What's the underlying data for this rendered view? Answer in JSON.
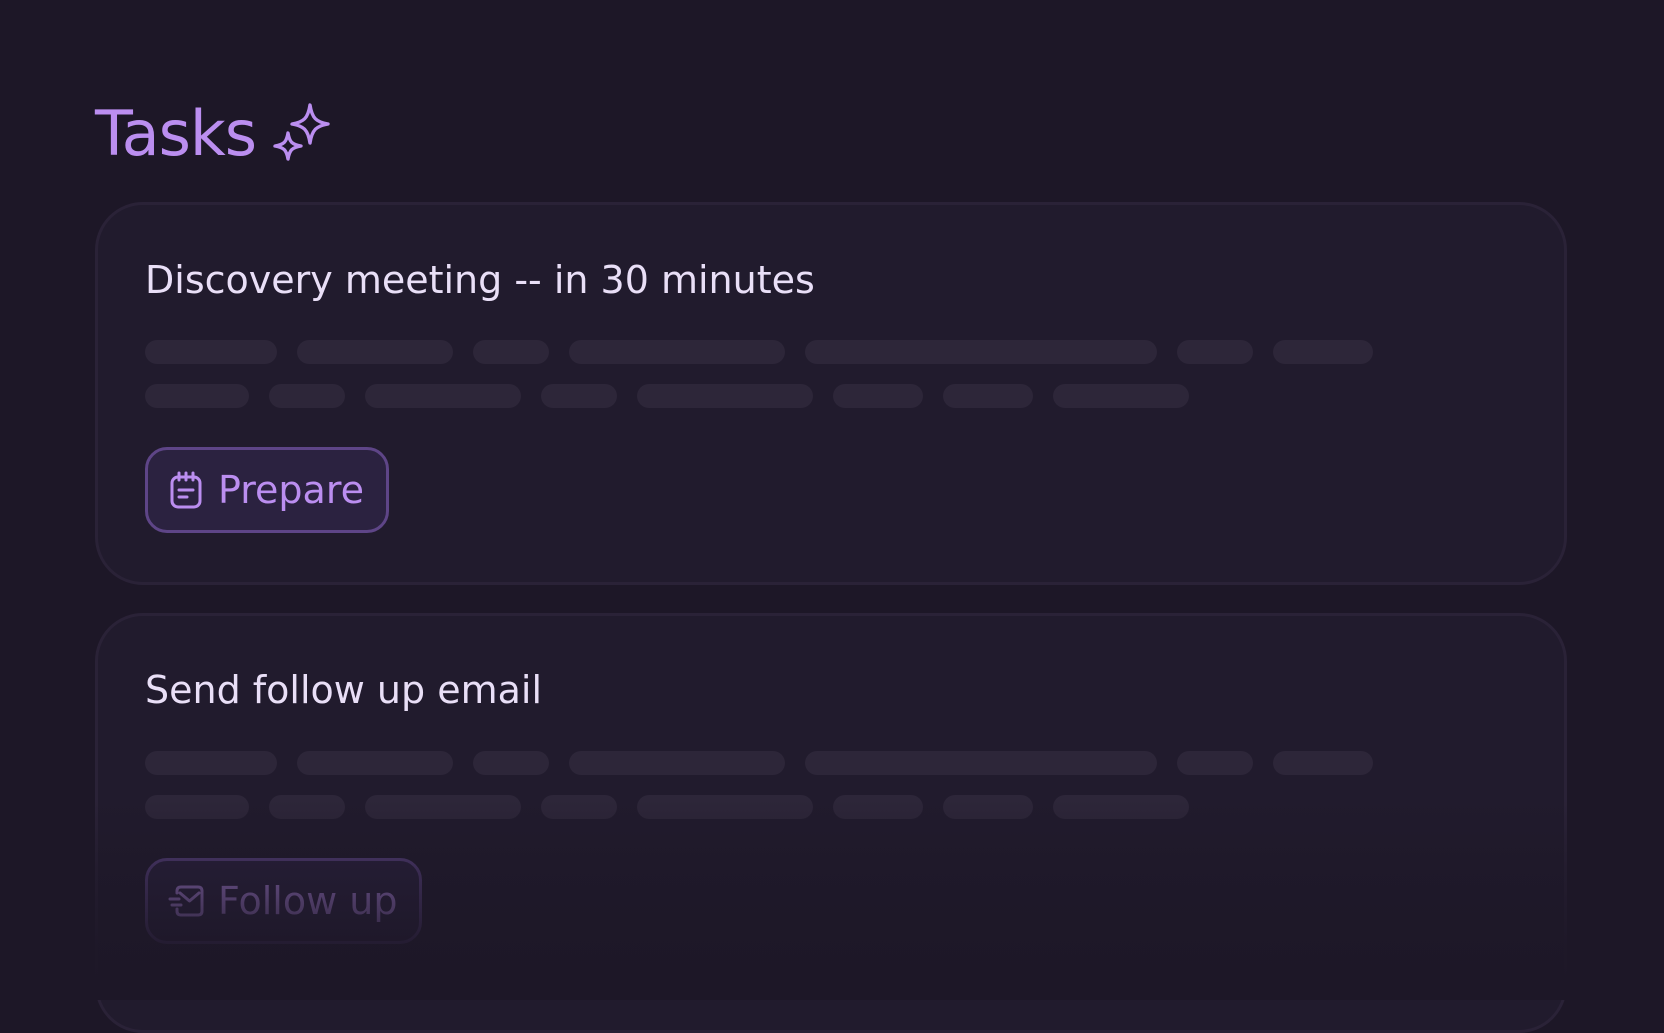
{
  "header": {
    "title": "Tasks",
    "icon": "sparkles-icon"
  },
  "tasks": [
    {
      "title": "Discovery meeting -- in 30 minutes",
      "action_label": "Prepare",
      "action_icon": "notepad-icon"
    },
    {
      "title": "Send follow up email",
      "action_label": "Follow up",
      "action_icon": "mail-send-icon"
    }
  ],
  "colors": {
    "background": "#1d1727",
    "card": "#211b2d",
    "accent": "#bb8ef0",
    "text": "#e9dff7",
    "skeleton": "#2d2639"
  }
}
